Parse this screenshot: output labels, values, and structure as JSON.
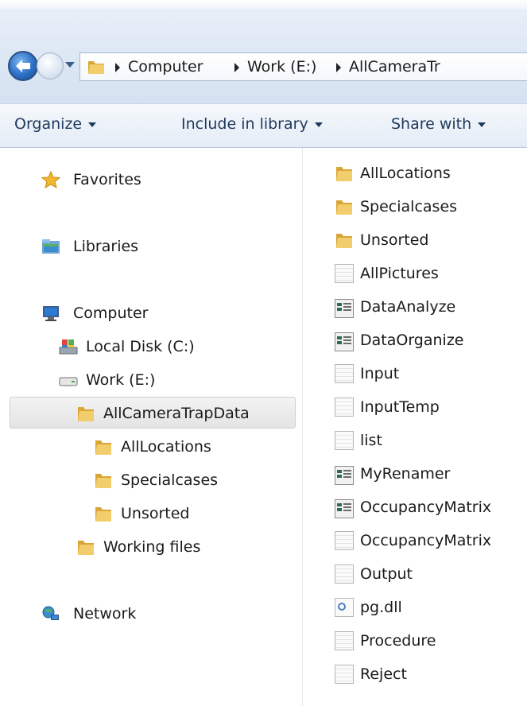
{
  "address_bar": {
    "crumbs": [
      "Computer",
      "Work (E:)",
      "AllCameraTr"
    ]
  },
  "command_bar": {
    "organize": "Organize",
    "include_in_library": "Include in library",
    "share_with": "Share with"
  },
  "nav_pane": {
    "favorites": "Favorites",
    "libraries": "Libraries",
    "computer": "Computer",
    "local_disk": "Local Disk (C:)",
    "work_drive": "Work (E:)",
    "selected_folder": "AllCameraTrapData",
    "subfolders": [
      "AllLocations",
      "Specialcases",
      "Unsorted"
    ],
    "working_files": "Working files",
    "network": "Network"
  },
  "files": [
    {
      "name": "AllLocations",
      "icon": "folder-icon"
    },
    {
      "name": "Specialcases",
      "icon": "folder-icon"
    },
    {
      "name": "Unsorted",
      "icon": "folder-icon"
    },
    {
      "name": "AllPictures",
      "icon": "text-file-icon"
    },
    {
      "name": "DataAnalyze",
      "icon": "executable-icon"
    },
    {
      "name": "DataOrganize",
      "icon": "executable-icon"
    },
    {
      "name": "Input",
      "icon": "text-file-icon"
    },
    {
      "name": "InputTemp",
      "icon": "text-file-icon"
    },
    {
      "name": "list",
      "icon": "text-file-icon"
    },
    {
      "name": "MyRenamer",
      "icon": "executable-icon"
    },
    {
      "name": "OccupancyMatrix",
      "icon": "executable-icon"
    },
    {
      "name": "OccupancyMatrix",
      "icon": "text-file-icon"
    },
    {
      "name": "Output",
      "icon": "text-file-icon"
    },
    {
      "name": "pg.dll",
      "icon": "dll-file-icon"
    },
    {
      "name": "Procedure",
      "icon": "text-file-icon"
    },
    {
      "name": "Reject",
      "icon": "text-file-icon"
    }
  ],
  "colors": {
    "chrome_top": "#e9f0f8",
    "command_text": "#1e395b",
    "folder_yellow": "#e8b84a",
    "selection": "#e4e4e4"
  }
}
